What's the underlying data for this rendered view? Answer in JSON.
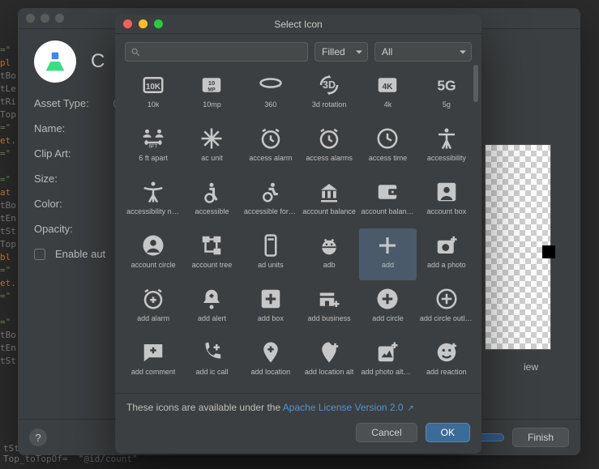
{
  "configure": {
    "title_letter": "C",
    "labels": {
      "asset_type": "Asset Type:",
      "name": "Name:",
      "clip_art": "Clip Art:",
      "size": "Size:",
      "color": "Color:",
      "opacity": "Opacity:",
      "enable_auto": "Enable aut"
    },
    "preview_label": "iew",
    "footer": {
      "help": "?",
      "next": "",
      "finish": "Finish"
    }
  },
  "modal": {
    "title": "Select Icon",
    "style_select": "Filled",
    "category_select": "All",
    "search_placeholder": "",
    "selected_icon": "add",
    "license_prefix": "These icons are available under the ",
    "license_link": "Apache License Version 2.0",
    "buttons": {
      "cancel": "Cancel",
      "ok": "OK"
    },
    "icons": [
      {
        "id": "10k",
        "label": "10k"
      },
      {
        "id": "10mp",
        "label": "10mp"
      },
      {
        "id": "360",
        "label": "360"
      },
      {
        "id": "3d_rotation",
        "label": "3d rotation"
      },
      {
        "id": "4k",
        "label": "4k"
      },
      {
        "id": "5g",
        "label": "5g"
      },
      {
        "id": "6_ft_apart",
        "label": "6 ft apart"
      },
      {
        "id": "ac_unit",
        "label": "ac unit"
      },
      {
        "id": "access_alarm",
        "label": "access alarm"
      },
      {
        "id": "access_alarms",
        "label": "access alarms"
      },
      {
        "id": "access_time",
        "label": "access time"
      },
      {
        "id": "accessibility",
        "label": "accessibility"
      },
      {
        "id": "accessibility_new",
        "label": "accessibility new"
      },
      {
        "id": "accessible",
        "label": "accessible"
      },
      {
        "id": "accessible_forward",
        "label": "accessible forward"
      },
      {
        "id": "account_balance",
        "label": "account balance"
      },
      {
        "id": "account_balance_wallet",
        "label": "account balance wallet"
      },
      {
        "id": "account_box",
        "label": "account box"
      },
      {
        "id": "account_circle",
        "label": "account circle"
      },
      {
        "id": "account_tree",
        "label": "account tree"
      },
      {
        "id": "ad_units",
        "label": "ad units"
      },
      {
        "id": "adb",
        "label": "adb"
      },
      {
        "id": "add",
        "label": "add"
      },
      {
        "id": "add_a_photo",
        "label": "add a photo"
      },
      {
        "id": "add_alarm",
        "label": "add alarm"
      },
      {
        "id": "add_alert",
        "label": "add alert"
      },
      {
        "id": "add_box",
        "label": "add box"
      },
      {
        "id": "add_business",
        "label": "add business"
      },
      {
        "id": "add_circle",
        "label": "add circle"
      },
      {
        "id": "add_circle_outline",
        "label": "add circle outline"
      },
      {
        "id": "add_comment",
        "label": "add comment"
      },
      {
        "id": "add_ic_call",
        "label": "add ic call"
      },
      {
        "id": "add_location",
        "label": "add location"
      },
      {
        "id": "add_location_alt",
        "label": "add location alt"
      },
      {
        "id": "add_photo_alternate",
        "label": "add photo alternate"
      },
      {
        "id": "add_reaction",
        "label": "add reaction"
      },
      {
        "id": "add_road",
        "label": ""
      },
      {
        "id": "add_shopping_cart",
        "label": ""
      },
      {
        "id": "add_task",
        "label": ""
      },
      {
        "id": "add_to_drive",
        "label": ""
      },
      {
        "id": "add_to_home_screen",
        "label": ""
      },
      {
        "id": "add_to_photos",
        "label": ""
      }
    ]
  }
}
